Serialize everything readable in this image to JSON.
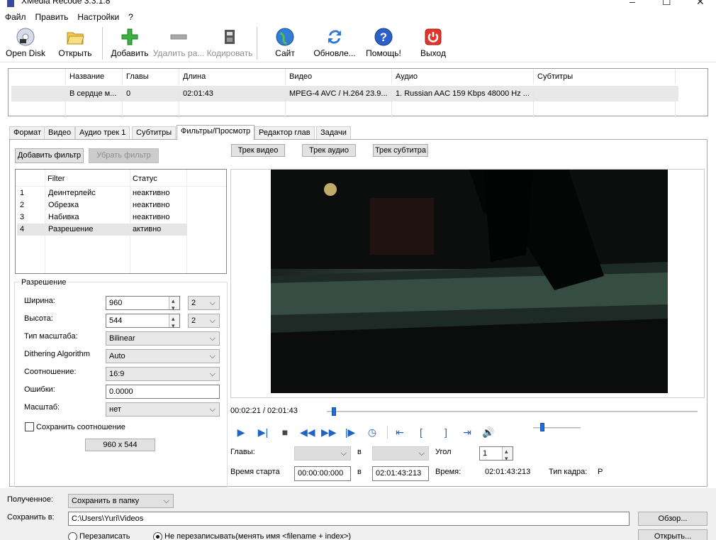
{
  "window": {
    "title": "XMedia Recode 3.3.1.8"
  },
  "menu": [
    "Файл",
    "Править",
    "Настройки",
    "?"
  ],
  "toolbar": {
    "open_disk": "Open Disk",
    "open": "Открыть",
    "add": "Добавить",
    "remove": "Удалить ра...",
    "encode": "Кодировать",
    "site": "Сайт",
    "update": "Обновле...",
    "help": "Помощь!",
    "exit": "Выход"
  },
  "file_table": {
    "headers": [
      "Название",
      "Главы",
      "Длина",
      "Видео",
      "Аудио",
      "Субтитры"
    ],
    "row": [
      "В сердце м...",
      "0",
      "02:01:43",
      "MPEG-4 AVC / H.264 23.9...",
      "1. Russian AAC  159 Kbps 48000 Hz ...",
      ""
    ]
  },
  "tabs": [
    "Формат",
    "Видео",
    "Аудио трек 1",
    "Субтитры",
    "Фильтры/Просмотр",
    "Редактор глав",
    "Задачи"
  ],
  "filters": {
    "add_button": "Добавить фильтр",
    "remove_button": "Убрать фильтр",
    "headers": [
      "Filter",
      "Статус"
    ],
    "rows": [
      {
        "num": "1",
        "name": "Деинтерлейс",
        "status": "неактивно"
      },
      {
        "num": "2",
        "name": "Обрезка",
        "status": "неактивно"
      },
      {
        "num": "3",
        "name": "Набивка",
        "status": "неактивно"
      },
      {
        "num": "4",
        "name": "Разрешение",
        "status": "активно"
      }
    ]
  },
  "resolution": {
    "legend": "Разрешение",
    "width_label": "Ширина:",
    "width_value": "960",
    "width_mult": "2",
    "height_label": "Высота:",
    "height_value": "544",
    "height_mult": "2",
    "scale_type_label": "Тип масштаба:",
    "scale_type": "Bilinear",
    "dithering_label": "Dithering Algorithm",
    "dithering": "Auto",
    "ratio_label": "Соотношение:",
    "ratio": "16:9",
    "errors_label": "Ошибки:",
    "errors": "0.0000",
    "scale_label": "Масштаб:",
    "scale": "нет",
    "keep_ratio": "Сохранить соотношение",
    "size_button": "960 x 544"
  },
  "preview": {
    "track_video": "Трек видео",
    "track_audio": "Трек аудио",
    "track_subtitle": "Трек субтитра",
    "time": "00:02:21 / 02:01:43",
    "seek_fraction": 0.019,
    "volume_fraction": 0.2,
    "chapters_label": "Главы:",
    "to_label": "в",
    "angle_label": "Угол",
    "angle": "1",
    "start_label": "Время старта",
    "start": "00:00:00:000",
    "end": "02:01:43:213",
    "duration_label": "Время:",
    "duration": "02:01:43:213",
    "frame_type_label": "Тип кадра:",
    "frame_type": "P"
  },
  "output": {
    "received_label": "Полученное:",
    "received": "Сохранить в папку",
    "save_to_label": "Сохранить в:",
    "path": "C:\\Users\\Yuri\\Videos",
    "browse": "Обзор...",
    "open": "Открыть...",
    "overwrite": "Перезаписать",
    "no_overwrite": "Не перезаписывать(менять имя <filename + index>)"
  }
}
